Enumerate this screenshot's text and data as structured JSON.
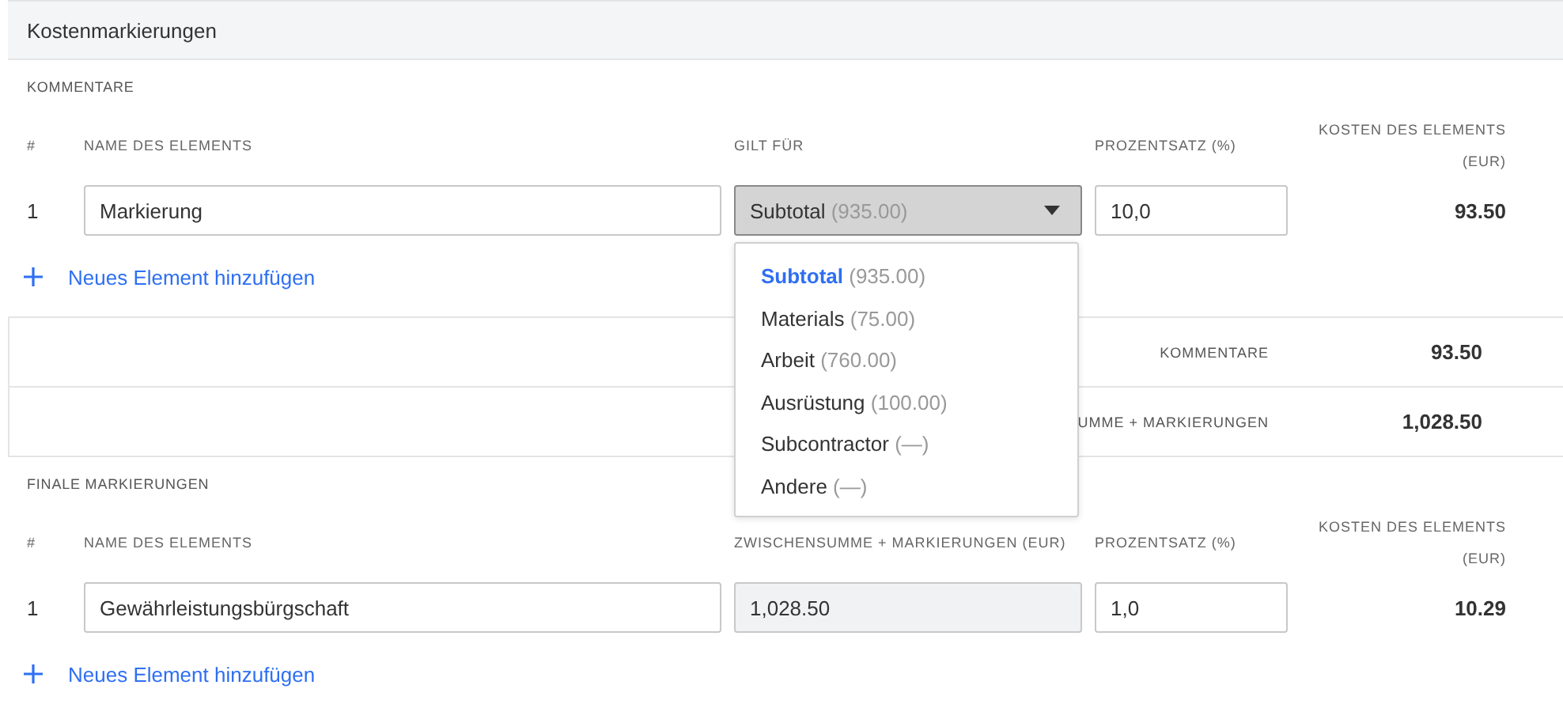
{
  "panel": {
    "title": "Kostenmarkierungen"
  },
  "comments": {
    "section_label": "KOMMENTARE",
    "columns": [
      "#",
      "NAME DES ELEMENTS",
      "GILT FÜR",
      "PROZENTSATZ (%)",
      "KOSTEN DES ELEMENTS (EUR)"
    ],
    "rows": [
      {
        "index": "1",
        "name": "Markierung",
        "applies_to": {
          "label": "Subtotal",
          "amount": "(935.00)",
          "open": true
        },
        "percent": "10,0",
        "cost": "93.50"
      }
    ],
    "add_link": "Neues Element hinzufügen",
    "dropdown_options": [
      {
        "label": "Subtotal",
        "amount": "(935.00)",
        "selected": true
      },
      {
        "label": "Materials",
        "amount": "(75.00)",
        "selected": false
      },
      {
        "label": "Arbeit",
        "amount": "(760.00)",
        "selected": false
      },
      {
        "label": "Ausrüstung",
        "amount": "(100.00)",
        "selected": false
      },
      {
        "label": "Subcontractor",
        "amount": "(—)",
        "selected": false
      },
      {
        "label": "Andere",
        "amount": "(—)",
        "selected": false
      }
    ]
  },
  "totals": [
    {
      "label": "KOMMENTARE",
      "value": "93.50"
    },
    {
      "label": "UMME + MARKIERUNGEN",
      "value": "1,028.50"
    }
  ],
  "final": {
    "section_label": "FINALE MARKIERUNGEN",
    "columns": [
      "#",
      "NAME DES ELEMENTS",
      "ZWISCHENSUMME + MARKIERUNGEN (EUR)",
      "PROZENTSATZ (%)",
      "KOSTEN DES ELEMENTS (EUR)"
    ],
    "rows": [
      {
        "index": "1",
        "name": "Gewährleistungsbürgschaft",
        "base": "1,028.50",
        "percent": "1,0",
        "cost": "10.29"
      }
    ],
    "add_link": "Neues Element hinzufügen"
  }
}
